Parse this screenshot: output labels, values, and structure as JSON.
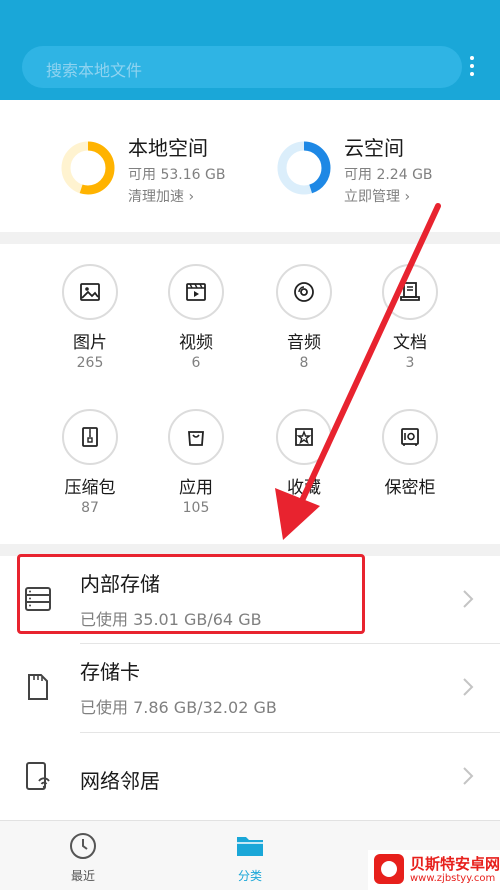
{
  "search": {
    "placeholder": "搜索本地文件"
  },
  "storage": {
    "local": {
      "title": "本地空间",
      "available": "可用 53.16 GB",
      "action": "清理加速 ›",
      "used_fraction": 0.55,
      "ring_color": "#ffb300",
      "ring_track": "#fff3d0"
    },
    "cloud": {
      "title": "云空间",
      "available": "可用 2.24 GB",
      "action": "立即管理 ›",
      "used_fraction": 0.45,
      "ring_color": "#1e88e5",
      "ring_track": "#dbeefb"
    }
  },
  "categories": [
    {
      "label": "图片",
      "count": "265",
      "icon": "image-icon"
    },
    {
      "label": "视频",
      "count": "6",
      "icon": "video-icon"
    },
    {
      "label": "音频",
      "count": "8",
      "icon": "audio-icon"
    },
    {
      "label": "文档",
      "count": "3",
      "icon": "document-icon"
    },
    {
      "label": "压缩包",
      "count": "87",
      "icon": "archive-icon"
    },
    {
      "label": "应用",
      "count": "105",
      "icon": "app-icon"
    },
    {
      "label": "收藏",
      "count": "",
      "icon": "favorite-icon"
    },
    {
      "label": "保密柜",
      "count": "",
      "icon": "safe-icon"
    }
  ],
  "locations": [
    {
      "title": "内部存储",
      "subtitle": "已使用 35.01 GB/64 GB",
      "icon": "internal-storage-icon"
    },
    {
      "title": "存储卡",
      "subtitle": "已使用 7.86 GB/32.02 GB",
      "icon": "sd-card-icon"
    },
    {
      "title": "网络邻居",
      "subtitle": "",
      "icon": "network-neighbor-icon"
    }
  ],
  "bottom_nav": [
    {
      "label": "最近",
      "icon": "clock-icon",
      "active": false
    },
    {
      "label": "分类",
      "icon": "folder-icon",
      "active": true
    }
  ],
  "watermark": {
    "name": "贝斯特安卓网",
    "url": "www.zjbstyy.com"
  },
  "colors": {
    "header": "#1aa7d8",
    "accent": "#1aa7d8",
    "highlight": "#e8232f",
    "arrow": "#e8232f"
  }
}
